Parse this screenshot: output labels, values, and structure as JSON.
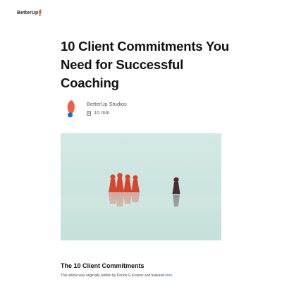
{
  "header": {
    "logo_text": "BetterUp",
    "logo_icon": "betterup-logo-icon",
    "accent_color": "#f0623e"
  },
  "article": {
    "title": "10 Client Commitments You Need for Successful Coaching",
    "author": {
      "name": "BetterUp Studios",
      "avatar_icon": "betterup-avatar-icon"
    },
    "read_time": "10 min",
    "read_time_icon": "book-icon",
    "hero_image": {
      "description_icon": "pawns-image",
      "background_color": "#cfe6e2"
    },
    "section_title": "The 10 Client Commitments",
    "attribution_prefix": "This article was originally written by Dorine G Kramer and featured ",
    "attribution_link": "here",
    "attribution_suffix": "."
  }
}
